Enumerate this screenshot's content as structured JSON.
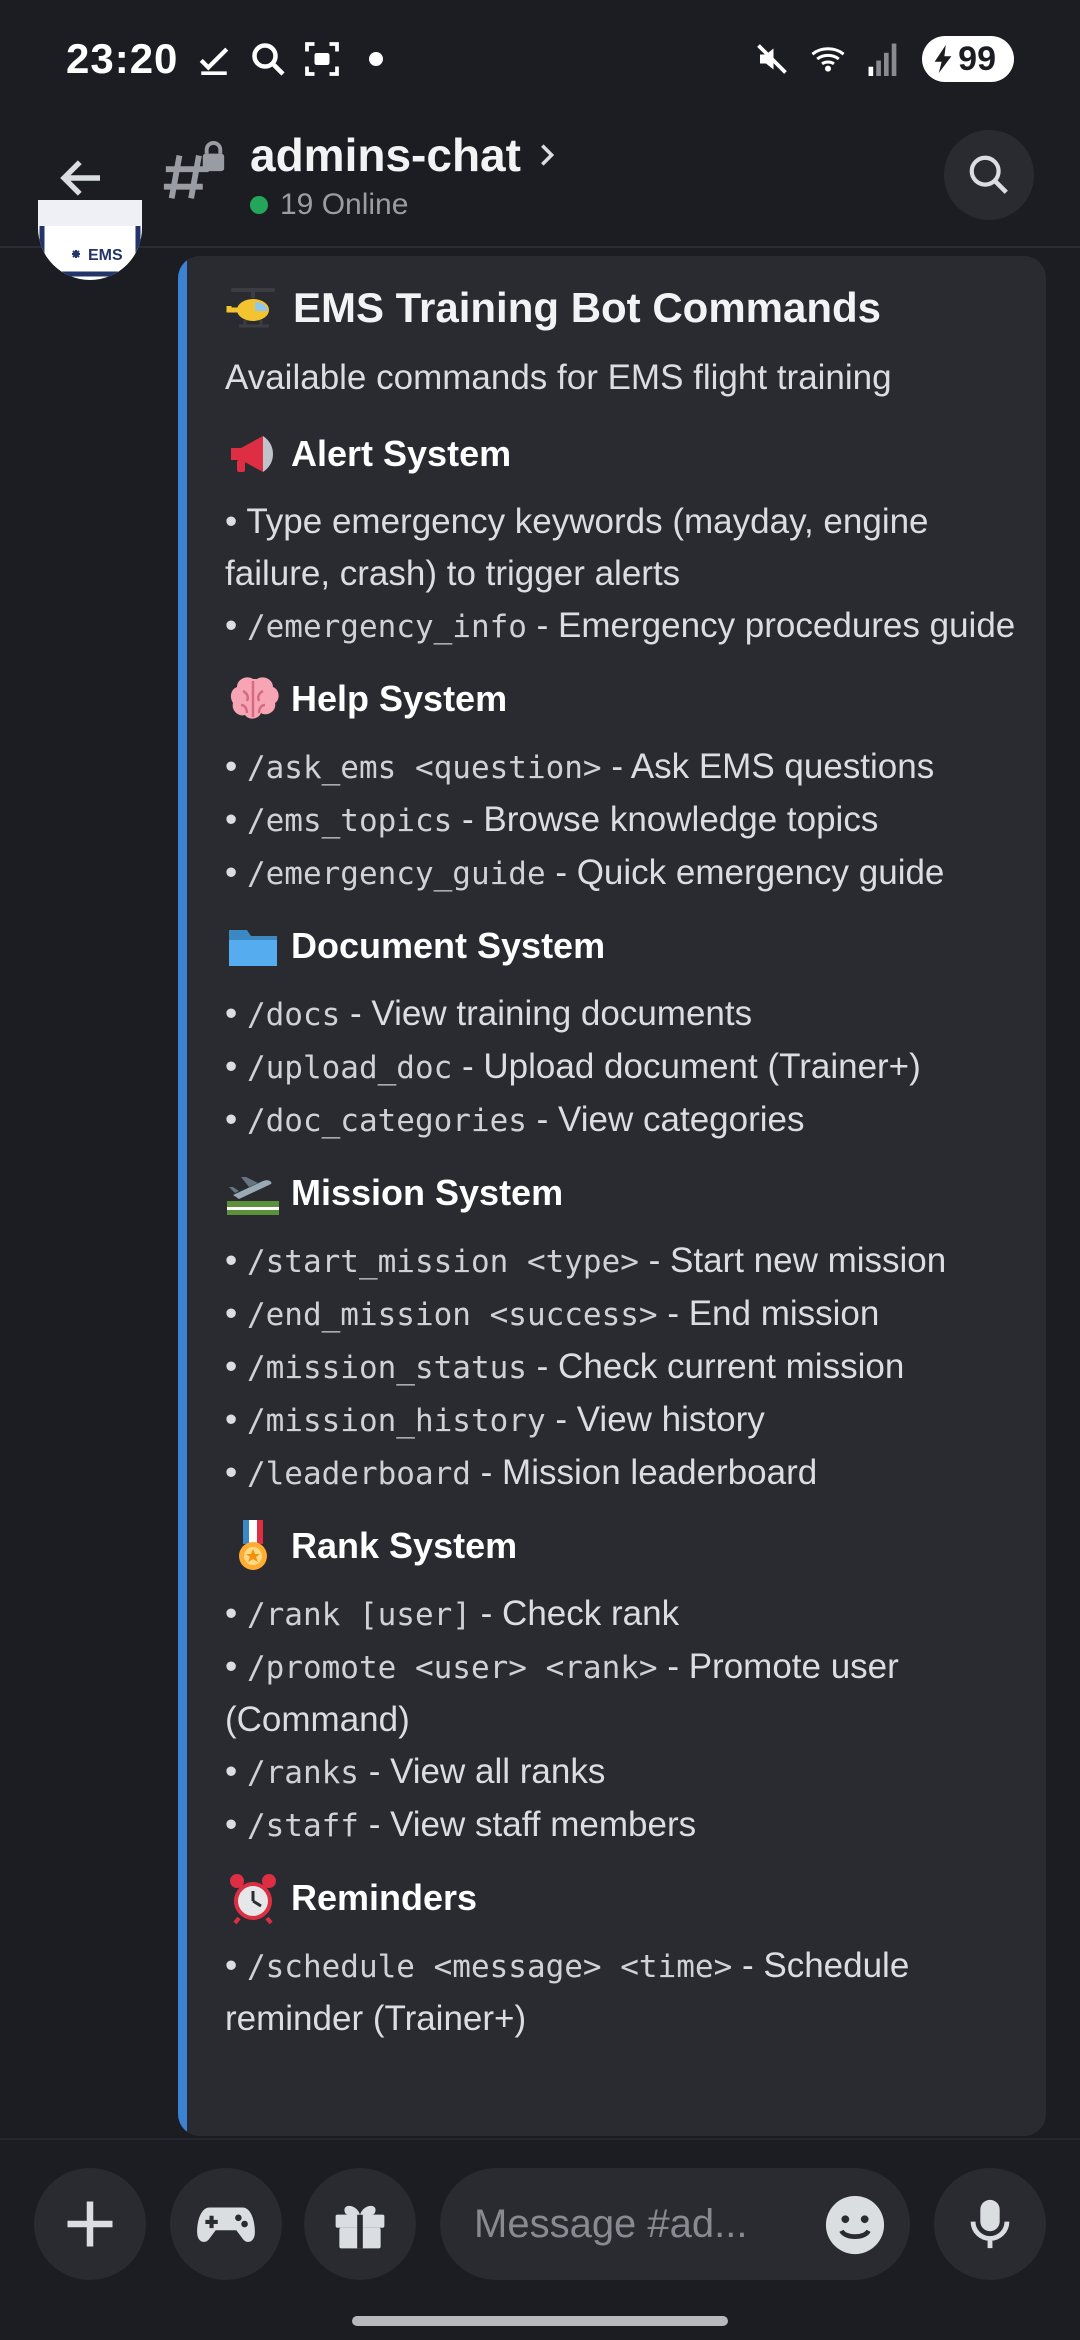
{
  "status": {
    "time": "23:20",
    "battery": "99"
  },
  "header": {
    "channel_name": "admins-chat",
    "online": "19 Online"
  },
  "avatar": {
    "label": "EMS"
  },
  "embed": {
    "title": "EMS Training Bot Commands",
    "description": "Available commands for EMS flight training",
    "accent_color": "#3b82d2",
    "sections": [
      {
        "title": "Alert System",
        "icon": "megaphone-icon",
        "items": [
          {
            "text": "• Type emergency keywords (mayday, engine failure, crash) to trigger alerts"
          },
          {
            "cmd": "/emergency_info",
            "desc": " - Emergency procedures guide"
          }
        ]
      },
      {
        "title": "Help System",
        "icon": "brain-icon",
        "items": [
          {
            "cmd": "/ask_ems <question>",
            "desc": " - Ask EMS questions"
          },
          {
            "cmd": "/ems_topics",
            "desc": " - Browse knowledge topics"
          },
          {
            "cmd": "/emergency_guide",
            "desc": " - Quick emergency guide"
          }
        ]
      },
      {
        "title": "Document System",
        "icon": "folder-icon",
        "items": [
          {
            "cmd": "/docs",
            "desc": " - View training documents"
          },
          {
            "cmd": "/upload_doc",
            "desc": " - Upload document (Trainer+)"
          },
          {
            "cmd": "/doc_categories",
            "desc": " - View categories"
          }
        ]
      },
      {
        "title": "Mission System",
        "icon": "airplane-departure-icon",
        "items": [
          {
            "cmd": "/start_mission <type>",
            "desc": " - Start new mission"
          },
          {
            "cmd": "/end_mission <success>",
            "desc": " - End mission"
          },
          {
            "cmd": "/mission_status",
            "desc": " - Check current mission"
          },
          {
            "cmd": "/mission_history",
            "desc": " - View history"
          },
          {
            "cmd": "/leaderboard",
            "desc": " - Mission leaderboard"
          }
        ]
      },
      {
        "title": "Rank System",
        "icon": "medal-icon",
        "items": [
          {
            "cmd": "/rank [user]",
            "desc": " - Check rank"
          },
          {
            "cmd": "/promote <user> <rank>",
            "desc": " - Promote user (Command)"
          },
          {
            "cmd": "/ranks",
            "desc": " - View all ranks"
          },
          {
            "cmd": "/staff",
            "desc": " - View staff members"
          }
        ]
      },
      {
        "title": "Reminders",
        "icon": "alarm-clock-icon",
        "items": [
          {
            "cmd": "/schedule <message> <time>",
            "desc": " - Schedule reminder (Trainer+)"
          }
        ]
      }
    ]
  },
  "composer": {
    "placeholder": "Message #ad..."
  }
}
